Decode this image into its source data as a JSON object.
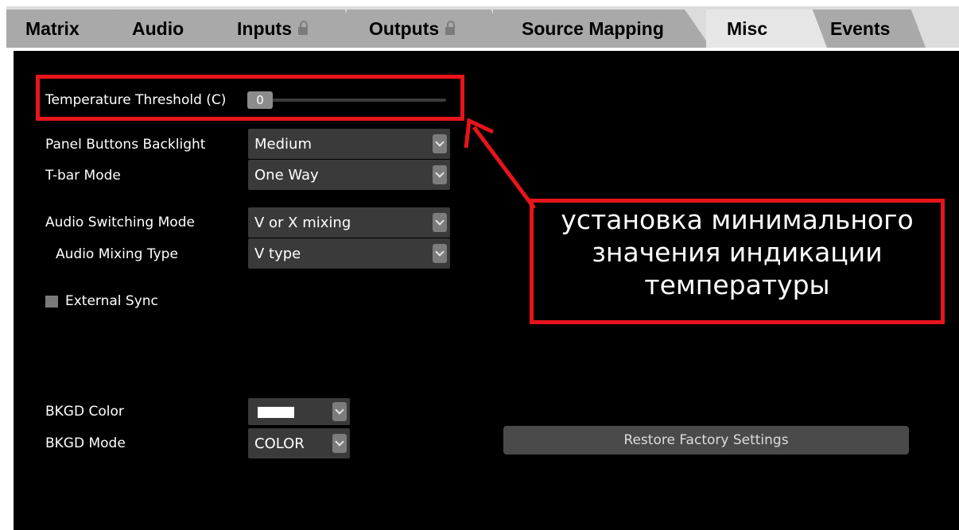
{
  "tabs": [
    {
      "label": "Matrix",
      "locked": false,
      "active": false
    },
    {
      "label": "Audio",
      "locked": false,
      "active": false
    },
    {
      "label": "Inputs",
      "locked": true,
      "active": false
    },
    {
      "label": "Outputs",
      "locked": true,
      "active": false
    },
    {
      "label": "Source Mapping",
      "locked": false,
      "active": false
    },
    {
      "label": "Misc",
      "locked": false,
      "active": true
    },
    {
      "label": "Events",
      "locked": false,
      "active": false
    }
  ],
  "settings": {
    "temperature_threshold": {
      "label": "Temperature Threshold (C)",
      "value": "0",
      "level": 0
    },
    "panel_backlight": {
      "label": "Panel Buttons Backlight",
      "value": "Medium"
    },
    "tbar_mode": {
      "label": "T-bar Mode",
      "value": "One Way"
    },
    "audio_switching": {
      "label": "Audio Switching Mode",
      "value": "V or X mixing"
    },
    "audio_mixing": {
      "label": "Audio Mixing Type",
      "value": "V type"
    },
    "external_sync": {
      "label": "External Sync",
      "checked": false
    },
    "bkgd_color": {
      "label": "BKGD Color",
      "swatch": "#ffffff"
    },
    "bkgd_mode": {
      "label": "BKGD Mode",
      "value": "COLOR"
    },
    "restore_label": "Restore Factory Settings"
  },
  "annotation": {
    "lines": [
      "установка минимального",
      "значения индикации",
      "температуры"
    ],
    "color": "#e8141b"
  },
  "colors": {
    "panel_bg": "#000000",
    "tab_bg": "#a9a9a9",
    "tab_active_bg": "#e6e6e6",
    "control_bg": "#3a3a3a"
  }
}
